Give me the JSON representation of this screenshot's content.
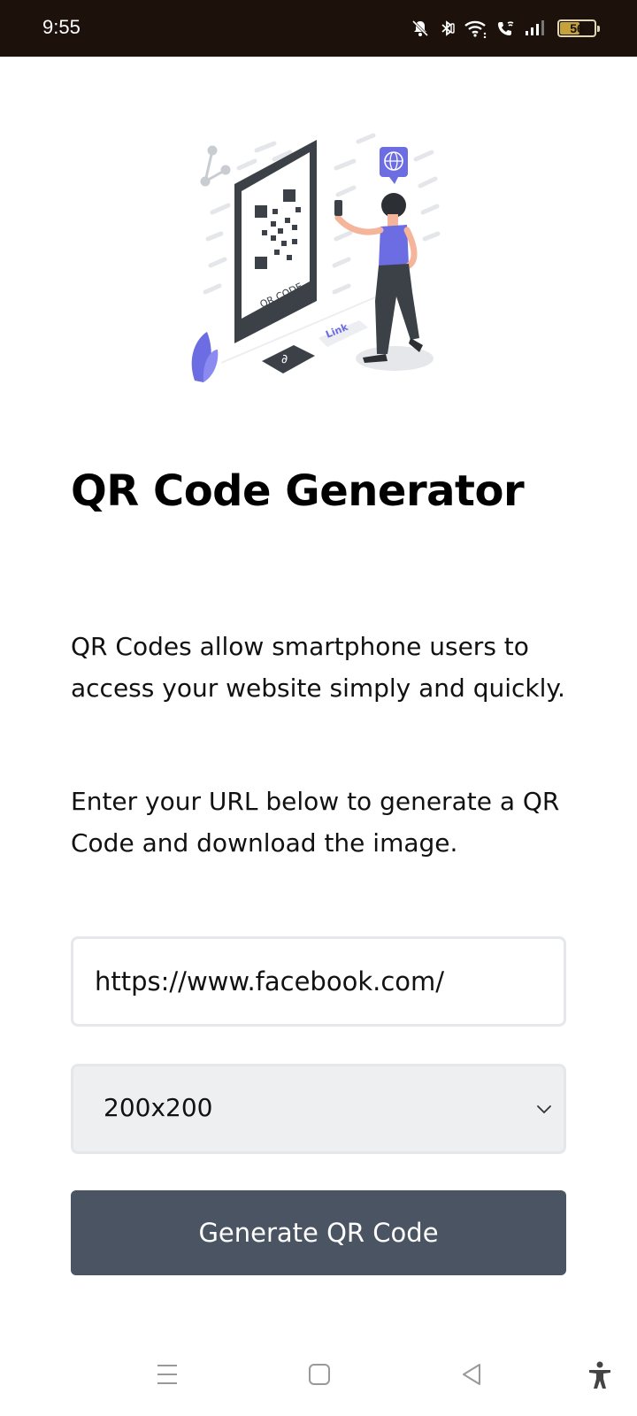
{
  "status_bar": {
    "time": "9:55",
    "battery_level": "56",
    "battery_percent": 56,
    "icons": [
      "bell-off-icon",
      "bluetooth-icon",
      "wifi-icon",
      "wifi-calling-icon",
      "signal-icon",
      "battery-icon"
    ]
  },
  "illustration": {
    "qr_label": "QR CODE",
    "link_label": "Link",
    "colors": {
      "accent": "#6c6ce3",
      "dark": "#3b4147"
    }
  },
  "page": {
    "title": "QR Code Generator",
    "paragraph1": "QR Codes allow smartphone users to access your website simply and quickly.",
    "paragraph2": "Enter your URL below to generate a QR Code and download the image."
  },
  "form": {
    "url_value": "https://www.facebook.com/",
    "size_selected": "200x200",
    "generate_label": "Generate QR Code"
  },
  "nav_bar": {
    "icons": [
      "recents-icon",
      "home-icon",
      "back-icon",
      "accessibility-icon"
    ]
  },
  "colors": {
    "button_bg": "#4a5463",
    "select_bg": "#eeeff1",
    "status_bar_bg": "#1c120b"
  }
}
